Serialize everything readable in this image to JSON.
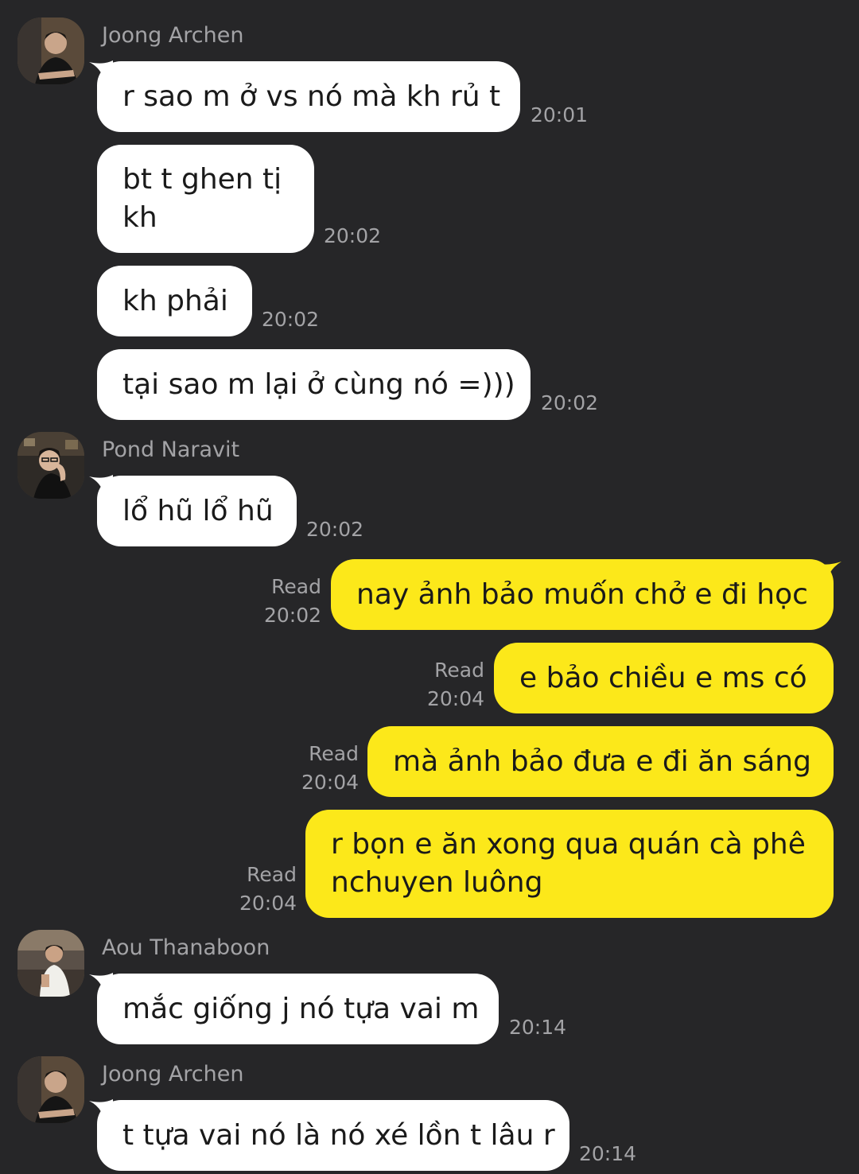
{
  "messages": [
    {
      "sender": "Joong Archen",
      "text": "r sao m ở vs nó mà kh rủ t",
      "time": "20:01"
    },
    {
      "text_line1": "bt t ghen tị",
      "text_line2": "kh",
      "time": "20:02"
    },
    {
      "text": "kh phải",
      "time": "20:02"
    },
    {
      "text": "tại sao m lại ở cùng nó =)))",
      "time": "20:02"
    },
    {
      "sender": "Pond Naravit",
      "text": "lổ hũ lổ hũ",
      "time": "20:02"
    },
    {
      "text": "nay ảnh bảo muốn chở e đi học",
      "status": "Read",
      "time": "20:02"
    },
    {
      "text": "e bảo chiều e ms có",
      "status": "Read",
      "time": "20:04"
    },
    {
      "text": "mà ảnh bảo đưa e đi ăn sáng",
      "status": "Read",
      "time": "20:04"
    },
    {
      "text_line1": "r bọn e ăn xong qua quán cà phê",
      "text_line2": "nchuyen luông",
      "status": "Read",
      "time": "20:04"
    },
    {
      "sender": "Aou Thanaboon",
      "text": "mắc giống j nó tựa vai m",
      "time": "20:14"
    },
    {
      "sender": "Joong Archen",
      "text": "t tựa vai nó là nó xé lồn t lâu r",
      "time": "20:14"
    }
  ],
  "colors": {
    "background": "#262628",
    "incoming_bubble": "#ffffff",
    "outgoing_bubble": "#fce81a",
    "meta_text": "#a3a3a6"
  },
  "icons": [
    "avatar-joong-archen",
    "avatar-pond-naravit",
    "avatar-aou-thanaboon"
  ]
}
